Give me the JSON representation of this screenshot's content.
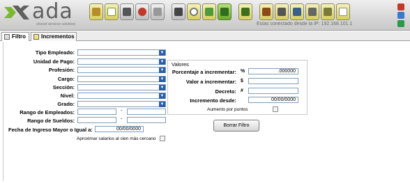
{
  "app": {
    "logo_text": "ada",
    "logo_tagline": "shared services solutions",
    "connection_status": "Estas conectado desde la IP: 192.168.101.1"
  },
  "toolbar": {
    "buttons": [
      {
        "icon": "edit-icon"
      },
      {
        "icon": "new-icon"
      },
      {
        "icon": "save-icon"
      },
      {
        "icon": "delete-icon"
      },
      {
        "icon": "undo-icon"
      },
      {
        "icon": "print-icon"
      },
      {
        "icon": "search-icon"
      },
      {
        "icon": "chart-icon"
      },
      {
        "icon": "export-icon"
      },
      {
        "icon": "user-icon"
      },
      {
        "icon": "camera-icon"
      },
      {
        "icon": "photo-icon"
      },
      {
        "icon": "grid-icon"
      },
      {
        "icon": "cart-icon"
      },
      {
        "icon": "config-icon"
      },
      {
        "icon": "document-icon"
      }
    ]
  },
  "tabs": [
    {
      "label": "Filtro"
    },
    {
      "label": "Incrementos"
    }
  ],
  "filters": {
    "tipo_empleado": "Tipo Empleado:",
    "unidad_pago": "Unidad de Pago:",
    "profesion": "Profesión:",
    "cargo": "Cargo:",
    "seccion": "Sección:",
    "nivel": "Nivel:",
    "grado": "Grado:",
    "rango_empleados": "Rango de Empleados:",
    "rango_sueldos": "Rango de Sueldos:",
    "fecha_ingreso": "Fecha de Ingreso Mayor o Igual a:",
    "fecha_ingreso_value": "00/00/0000",
    "aproximar": "Aproximar salarios al cien más cercano",
    "range_separator": "-"
  },
  "valores": {
    "title": "Valores",
    "porcentaje_label": "Porcentaje a incrementar:",
    "porcentaje_symbol": "%",
    "porcentaje_value": ".000000",
    "valor_label": "Valor a incrementar:",
    "valor_symbol": "$",
    "decreto_label": "Decreto:",
    "decreto_symbol": "#",
    "incremento_label": "Incremento desde:",
    "incremento_value": "00/00/0000",
    "aumento_puntos": "Aumento por puntos"
  },
  "actions": {
    "borrar_filtro": "Borrar Filtro"
  },
  "colors": {
    "dropdown_arrow": "#2a5da8",
    "toolbar_yellow": "#d8cf5e",
    "toolbar_green": "#6aa92c",
    "logo_green": "#7cb82f",
    "logo_gray": "#5f5f5f"
  }
}
